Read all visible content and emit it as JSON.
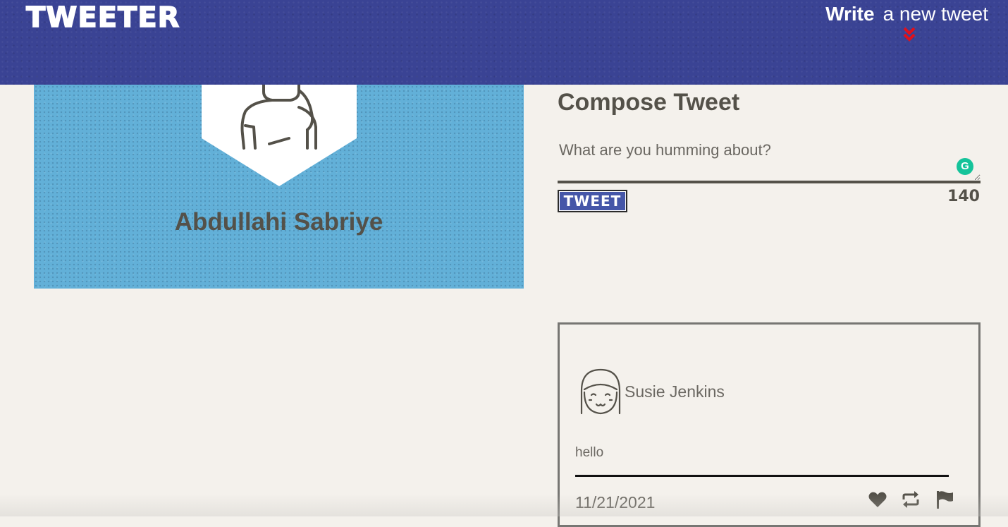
{
  "nav": {
    "logo": "TWEETER",
    "write_bold": "Write",
    "write_rest": "a new tweet",
    "chevron_icon": "double-chevron-down",
    "chevron_color": "#e0101b",
    "background": "#3a4394"
  },
  "profile": {
    "name": "Abdullahi Sabriye",
    "avatar_icon": "user-avatar-icon",
    "background": "#62b0d8"
  },
  "compose": {
    "title": "Compose Tweet",
    "placeholder": "What are you humming about?",
    "button_label": "TWEET",
    "counter": "140",
    "grammarly_letter": "G"
  },
  "tweet": {
    "author": "Susie Jenkins",
    "body": "hello",
    "date": "11/21/2021",
    "actions": [
      "heart-icon",
      "retweet-icon",
      "flag-icon"
    ]
  }
}
